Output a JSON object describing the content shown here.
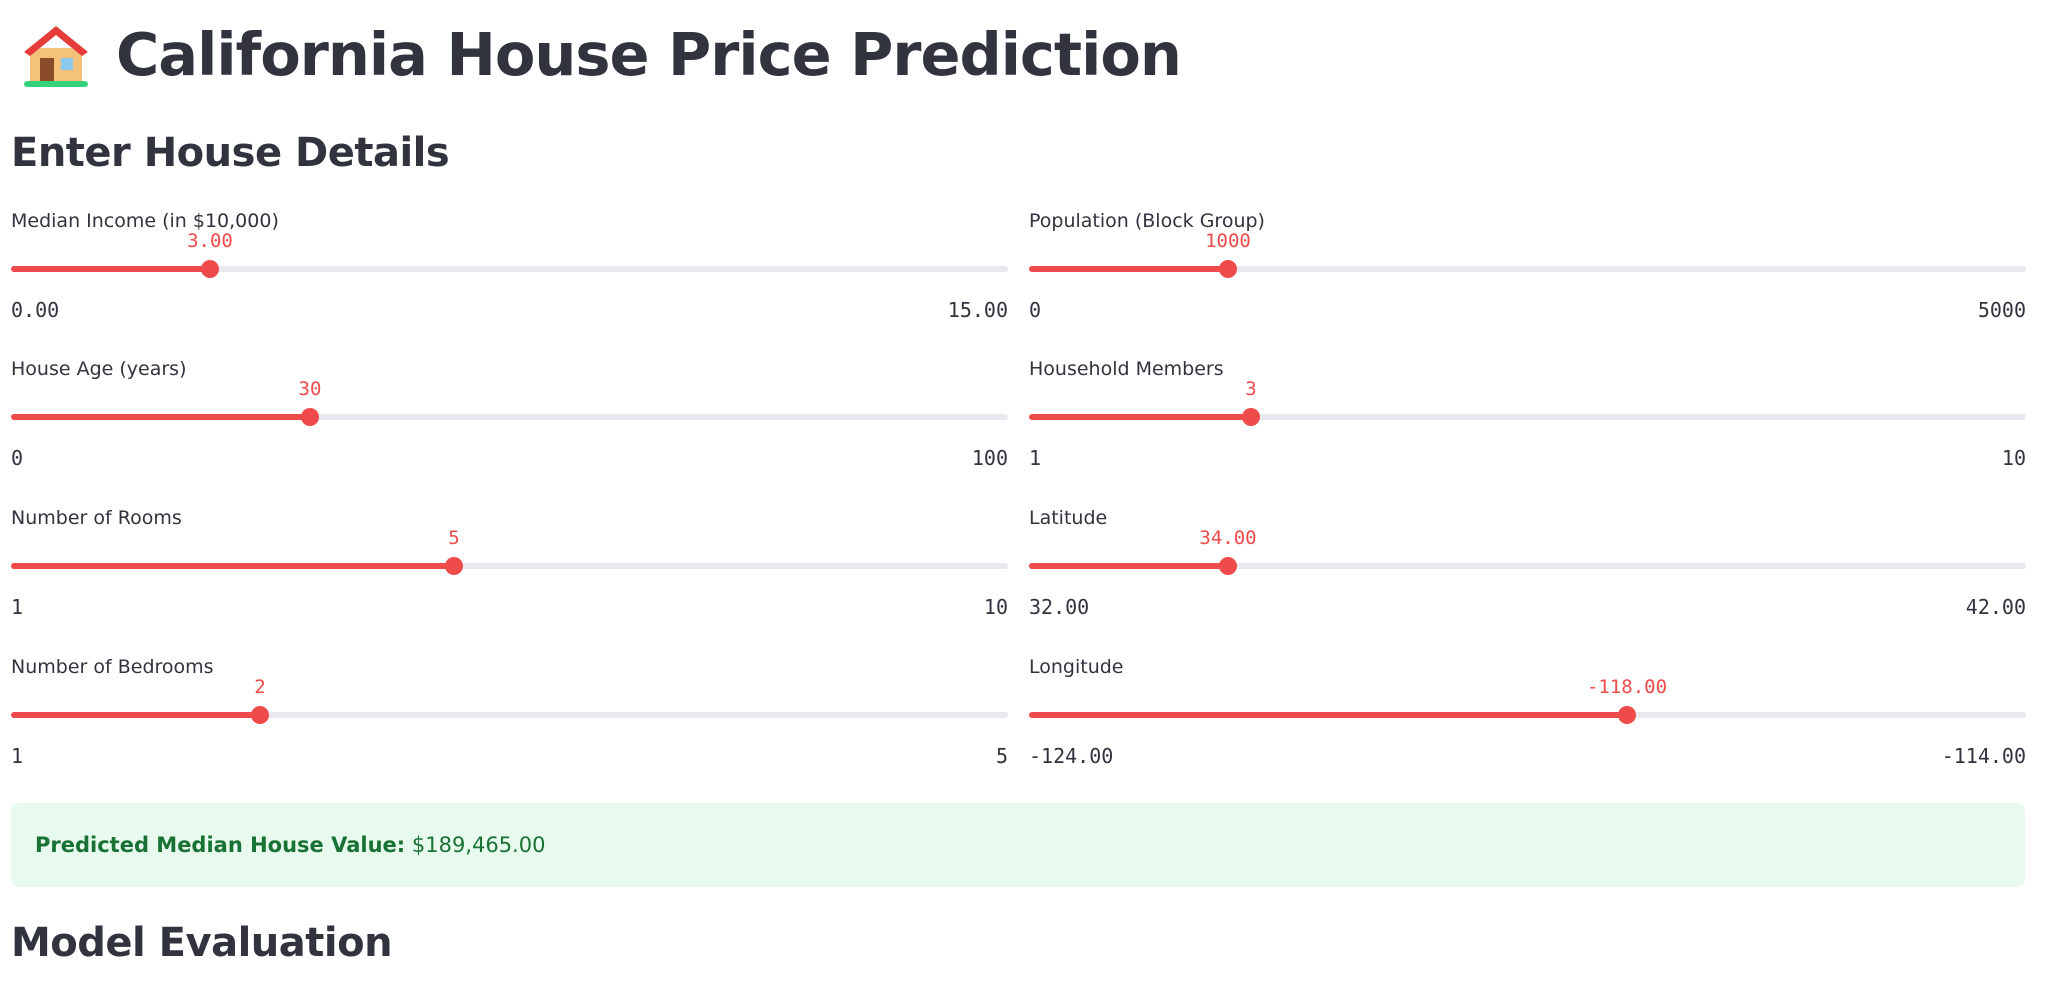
{
  "page": {
    "title": "California House Price Prediction",
    "icon": "house-icon"
  },
  "sections": {
    "details": "Enter House Details",
    "evaluation": "Model Evaluation"
  },
  "sliders": [
    {
      "id": "median-income",
      "label": "Median Income (in $10,000)",
      "value_label": "3.00",
      "min_label": "0.00",
      "max_label": "15.00",
      "min": 0,
      "max": 15,
      "value": 3
    },
    {
      "id": "population",
      "label": "Population (Block Group)",
      "value_label": "1000",
      "min_label": "0",
      "max_label": "5000",
      "min": 0,
      "max": 5000,
      "value": 1000
    },
    {
      "id": "house-age",
      "label": "House Age (years)",
      "value_label": "30",
      "min_label": "0",
      "max_label": "100",
      "min": 0,
      "max": 100,
      "value": 30
    },
    {
      "id": "household-members",
      "label": "Household Members",
      "value_label": "3",
      "min_label": "1",
      "max_label": "10",
      "min": 1,
      "max": 10,
      "value": 3
    },
    {
      "id": "rooms",
      "label": "Number of Rooms",
      "value_label": "5",
      "min_label": "1",
      "max_label": "10",
      "min": 1,
      "max": 10,
      "value": 5
    },
    {
      "id": "latitude",
      "label": "Latitude",
      "value_label": "34.00",
      "min_label": "32.00",
      "max_label": "42.00",
      "min": 32,
      "max": 42,
      "value": 34
    },
    {
      "id": "bedrooms",
      "label": "Number of Bedrooms",
      "value_label": "2",
      "min_label": "1",
      "max_label": "5",
      "min": 1,
      "max": 5,
      "value": 2
    },
    {
      "id": "longitude",
      "label": "Longitude",
      "value_label": "-118.00",
      "min_label": "-124.00",
      "max_label": "-114.00",
      "min": -124,
      "max": -114,
      "value": -118
    }
  ],
  "result": {
    "label": "Predicted Median House Value:",
    "value": "$189,465.00"
  },
  "colors": {
    "accent": "#ef4b4b",
    "track": "#e8e8ee",
    "success_bg": "#e8f9ee",
    "success_text": "#177233",
    "text": "#31333f"
  }
}
